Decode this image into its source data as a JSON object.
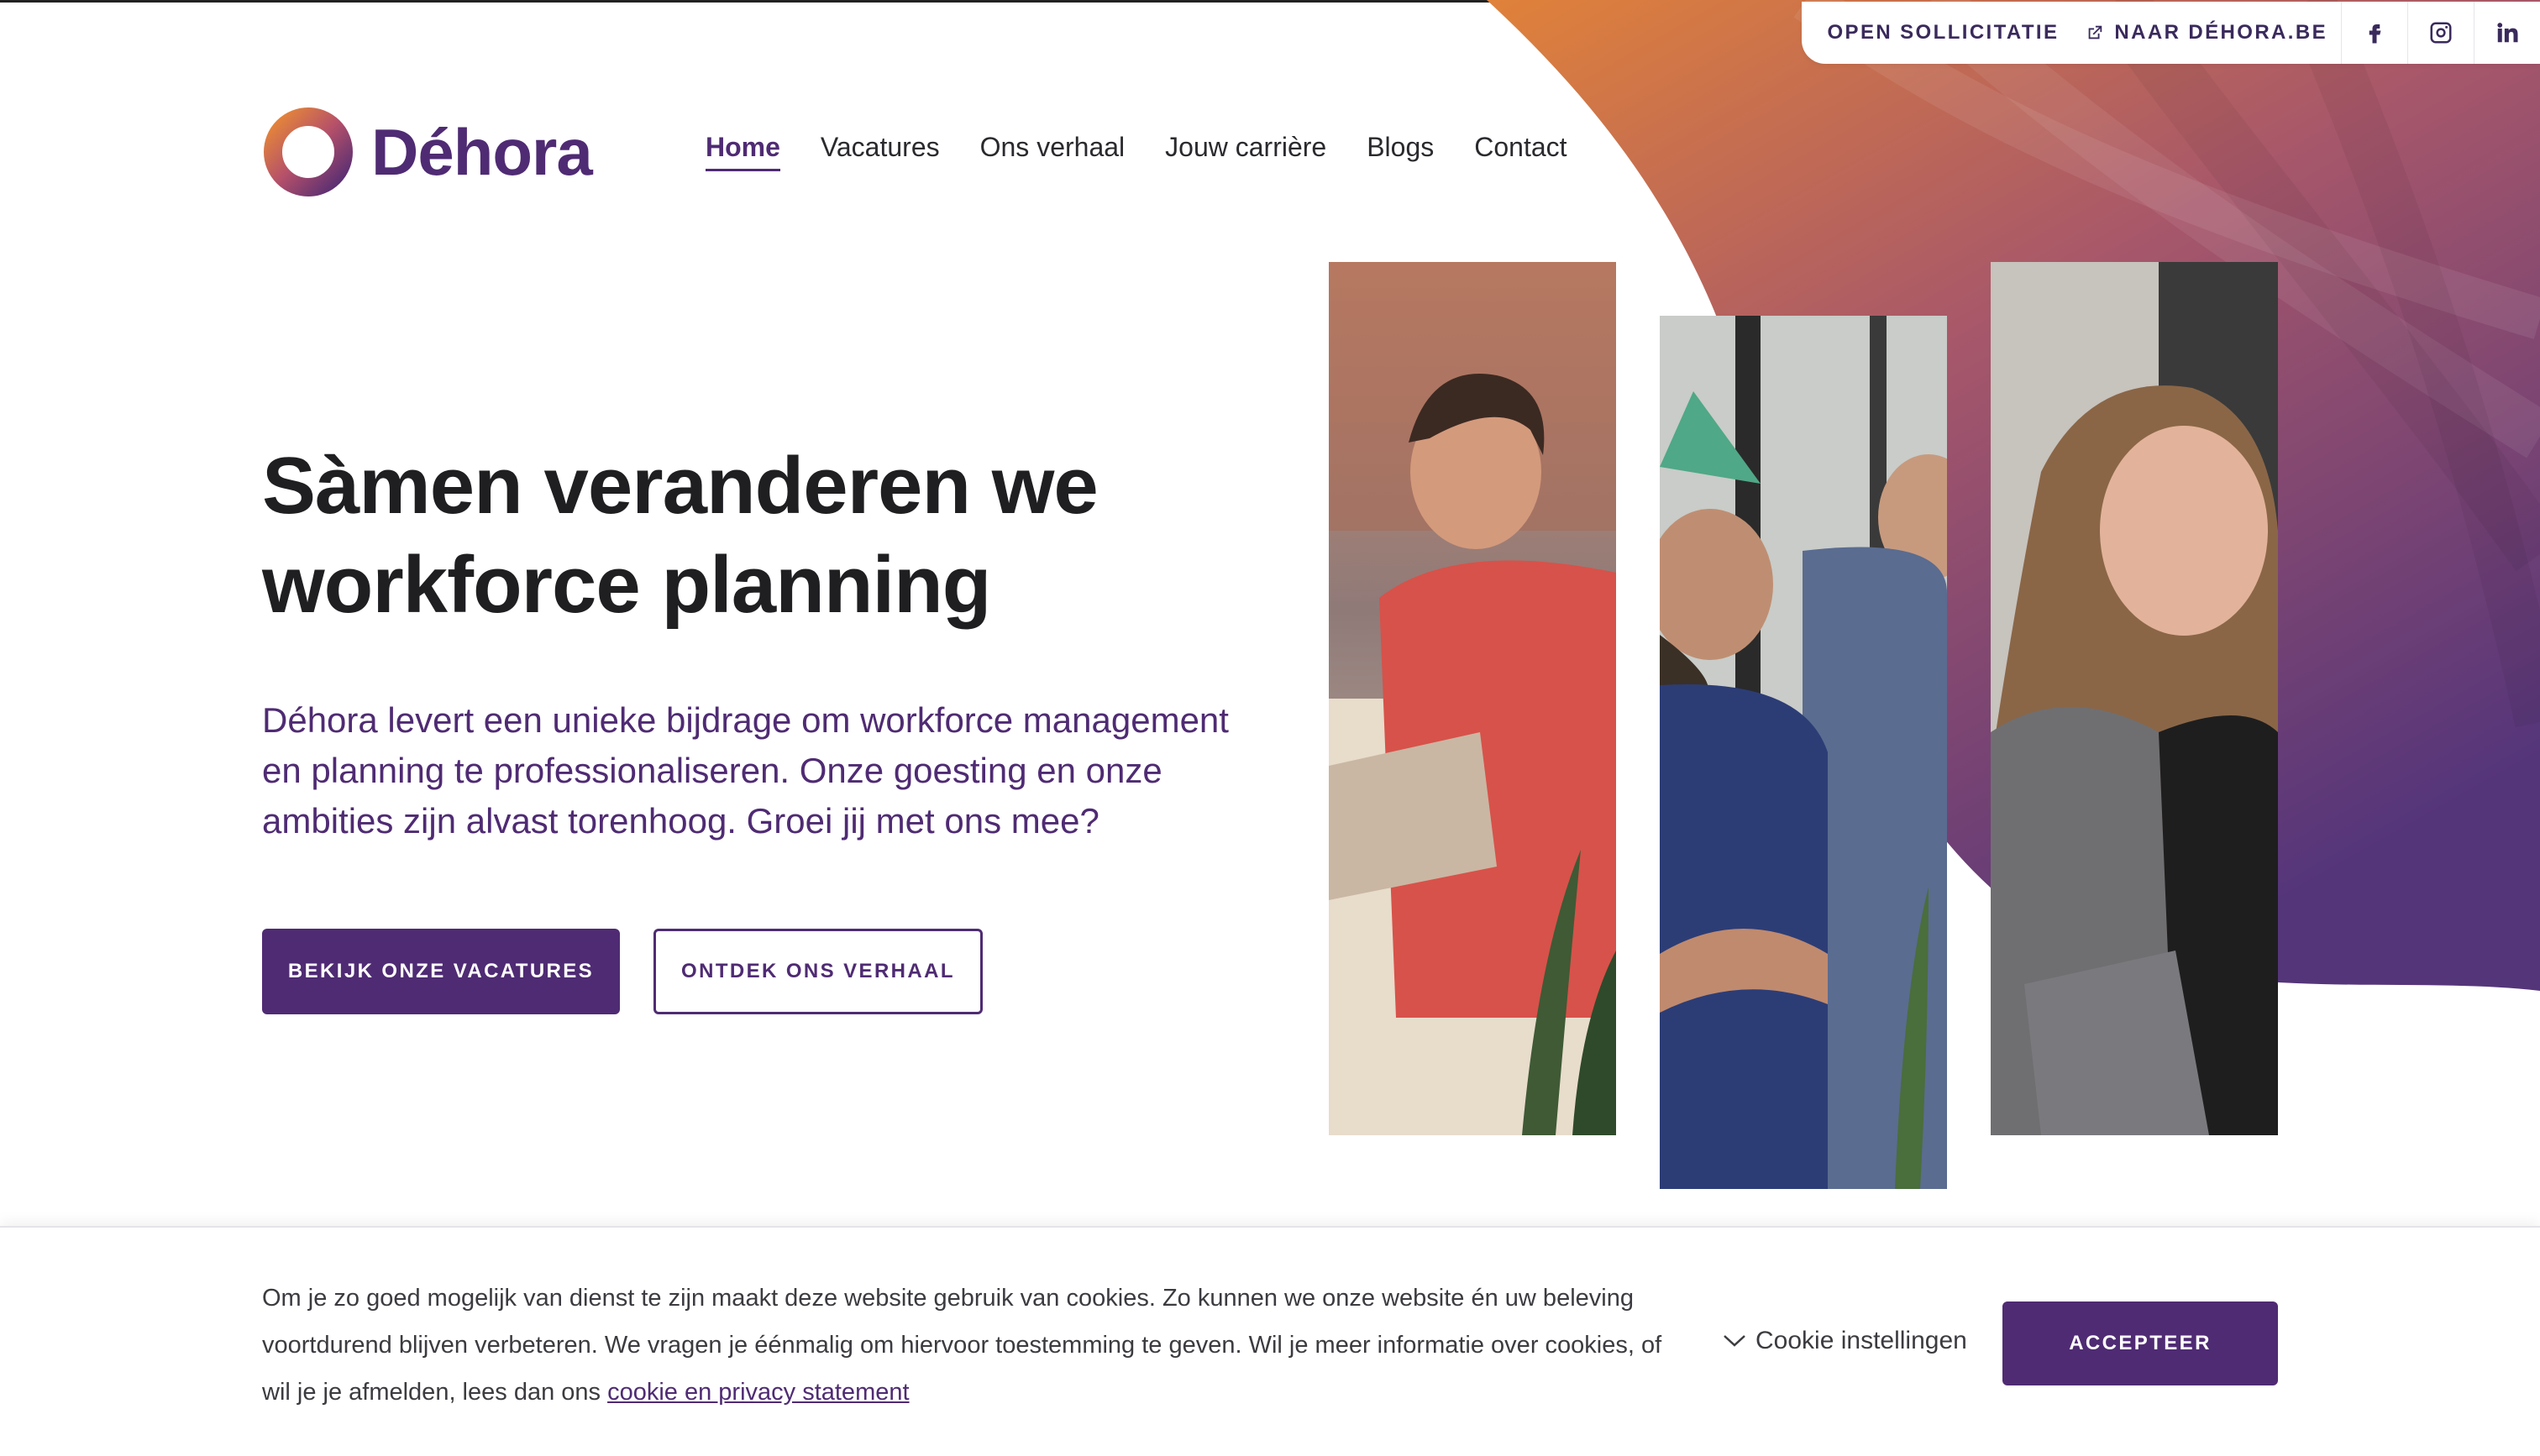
{
  "colors": {
    "brand_purple": "#4f2b73",
    "brand_orange": "#e0823a",
    "heading": "#1f1f22"
  },
  "topbar": {
    "open_sollicitatie": "OPEN SOLLICITATIE",
    "naar_dehora": "NAAR DÉHORA.BE",
    "external_icon": "external-link-icon",
    "social": [
      "facebook-icon",
      "instagram-icon",
      "linkedin-icon"
    ]
  },
  "logo": {
    "text": "Déhora",
    "icon": "ring-logo-icon"
  },
  "nav": {
    "items": [
      "Home",
      "Vacatures",
      "Ons verhaal",
      "Jouw carrière",
      "Blogs",
      "Contact"
    ],
    "active": "Home"
  },
  "hero": {
    "title_line1": "Sàmen veranderen we",
    "title_line2": "workforce planning",
    "description": "Déhora levert een unieke bijdrage om workforce management en planning te professionaliseren. Onze goesting en onze ambities zijn alvast torenhoog. Groei jij met ons mee?",
    "primary_button": "BEKIJK ONZE VACATURES",
    "secondary_button": "ONTDEK ONS VERHAAL"
  },
  "cookie": {
    "text": "Om je zo goed mogelijk van dienst te zijn maakt deze website gebruik van cookies. Zo kunnen we onze website én uw beleving voortdurend blijven verbeteren. We vragen je éénmalig om hiervoor toestemming te geven.  Wil je meer informatie over cookies, of wil je je afmelden, lees dan ons ",
    "link": "cookie en privacy statement",
    "settings": "Cookie instellingen",
    "accept": "ACCEPTEER"
  }
}
